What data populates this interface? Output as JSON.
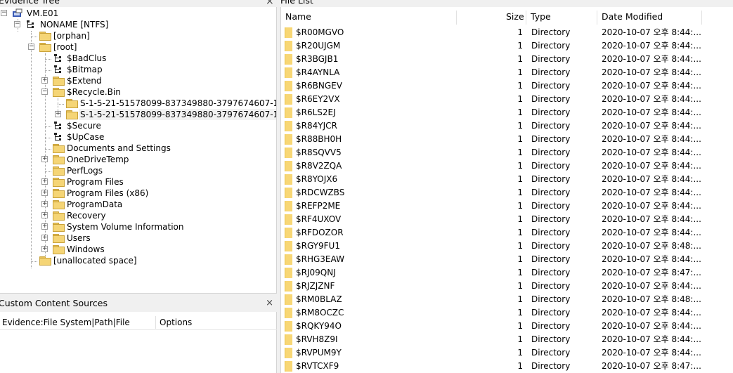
{
  "evidence_tree": {
    "title": "Evidence Tree",
    "close": "×",
    "nodes": [
      {
        "label": "VM.E01",
        "icon": "evidence-icon",
        "expander": "−"
      },
      {
        "label": "NONAME [NTFS]",
        "icon": "filesystem-icon",
        "expander": "−"
      },
      {
        "label": "[orphan]",
        "icon": "folder-icon",
        "expander": ""
      },
      {
        "label": "[root]",
        "icon": "folder-icon",
        "expander": "−"
      },
      {
        "label": "$BadClus",
        "icon": "filesystem-icon",
        "expander": ""
      },
      {
        "label": "$Bitmap",
        "icon": "filesystem-icon",
        "expander": ""
      },
      {
        "label": "$Extend",
        "icon": "folder-icon",
        "expander": "+"
      },
      {
        "label": "$Recycle.Bin",
        "icon": "folder-icon",
        "expander": "−"
      },
      {
        "label": "S-1-5-21-51578099-837349880-3797674607-1000",
        "icon": "folder-icon",
        "expander": ""
      },
      {
        "label": "S-1-5-21-51578099-837349880-3797674607-1001",
        "icon": "folder-icon",
        "expander": "+"
      },
      {
        "label": "$Secure",
        "icon": "filesystem-icon",
        "expander": ""
      },
      {
        "label": "$UpCase",
        "icon": "filesystem-icon",
        "expander": ""
      },
      {
        "label": "Documents and Settings",
        "icon": "folder-icon",
        "expander": ""
      },
      {
        "label": "OneDriveTemp",
        "icon": "folder-icon",
        "expander": "+"
      },
      {
        "label": "PerfLogs",
        "icon": "folder-icon",
        "expander": ""
      },
      {
        "label": "Program Files",
        "icon": "folder-icon",
        "expander": "+"
      },
      {
        "label": "Program Files (x86)",
        "icon": "folder-icon",
        "expander": "+"
      },
      {
        "label": "ProgramData",
        "icon": "folder-icon",
        "expander": "+"
      },
      {
        "label": "Recovery",
        "icon": "folder-icon",
        "expander": "+"
      },
      {
        "label": "System Volume Information",
        "icon": "folder-icon",
        "expander": "+"
      },
      {
        "label": "Users",
        "icon": "folder-icon",
        "expander": "+"
      },
      {
        "label": "Windows",
        "icon": "folder-icon",
        "expander": "+"
      },
      {
        "label": "[unallocated space]",
        "icon": "folder-icon",
        "expander": ""
      }
    ]
  },
  "custom_content_sources": {
    "title": "Custom Content Sources",
    "close": "×",
    "columns": [
      "Evidence:File System|Path|File",
      "Options"
    ]
  },
  "file_list": {
    "title": "File List",
    "columns": {
      "name": "Name",
      "size": "Size",
      "type": "Type",
      "date": "Date Modified"
    },
    "rows": [
      {
        "name": "$R00MGVO",
        "size": "1",
        "type": "Directory",
        "date": "2020-10-07 오후 8:44:..."
      },
      {
        "name": "$R20UJGM",
        "size": "1",
        "type": "Directory",
        "date": "2020-10-07 오후 8:44:..."
      },
      {
        "name": "$R3BGJB1",
        "size": "1",
        "type": "Directory",
        "date": "2020-10-07 오후 8:44:..."
      },
      {
        "name": "$R4AYNLA",
        "size": "1",
        "type": "Directory",
        "date": "2020-10-07 오후 8:44:..."
      },
      {
        "name": "$R6BNGEV",
        "size": "1",
        "type": "Directory",
        "date": "2020-10-07 오후 8:44:..."
      },
      {
        "name": "$R6EY2VX",
        "size": "1",
        "type": "Directory",
        "date": "2020-10-07 오후 8:44:..."
      },
      {
        "name": "$R6LS2EJ",
        "size": "1",
        "type": "Directory",
        "date": "2020-10-07 오후 8:44:..."
      },
      {
        "name": "$R84YJCR",
        "size": "1",
        "type": "Directory",
        "date": "2020-10-07 오후 8:44:..."
      },
      {
        "name": "$R88BH0H",
        "size": "1",
        "type": "Directory",
        "date": "2020-10-07 오후 8:44:..."
      },
      {
        "name": "$R8SQVV5",
        "size": "1",
        "type": "Directory",
        "date": "2020-10-07 오후 8:44:..."
      },
      {
        "name": "$R8V2ZQA",
        "size": "1",
        "type": "Directory",
        "date": "2020-10-07 오후 8:44:..."
      },
      {
        "name": "$R8YOJX6",
        "size": "1",
        "type": "Directory",
        "date": "2020-10-07 오후 8:44:..."
      },
      {
        "name": "$RDCWZBS",
        "size": "1",
        "type": "Directory",
        "date": "2020-10-07 오후 8:44:..."
      },
      {
        "name": "$REFP2ME",
        "size": "1",
        "type": "Directory",
        "date": "2020-10-07 오후 8:44:..."
      },
      {
        "name": "$RF4UXOV",
        "size": "1",
        "type": "Directory",
        "date": "2020-10-07 오후 8:44:..."
      },
      {
        "name": "$RFDOZOR",
        "size": "1",
        "type": "Directory",
        "date": "2020-10-07 오후 8:44:..."
      },
      {
        "name": "$RGY9FU1",
        "size": "1",
        "type": "Directory",
        "date": "2020-10-07 오후 8:48:..."
      },
      {
        "name": "$RHG3EAW",
        "size": "1",
        "type": "Directory",
        "date": "2020-10-07 오후 8:44:..."
      },
      {
        "name": "$RJ09QNJ",
        "size": "1",
        "type": "Directory",
        "date": "2020-10-07 오후 8:47:..."
      },
      {
        "name": "$RJZJZNF",
        "size": "1",
        "type": "Directory",
        "date": "2020-10-07 오후 8:44:..."
      },
      {
        "name": "$RM0BLAZ",
        "size": "1",
        "type": "Directory",
        "date": "2020-10-07 오후 8:48:..."
      },
      {
        "name": "$RM8OCZC",
        "size": "1",
        "type": "Directory",
        "date": "2020-10-07 오후 8:44:..."
      },
      {
        "name": "$RQKY94O",
        "size": "1",
        "type": "Directory",
        "date": "2020-10-07 오후 8:44:..."
      },
      {
        "name": "$RVH8Z9I",
        "size": "1",
        "type": "Directory",
        "date": "2020-10-07 오후 8:44:..."
      },
      {
        "name": "$RVPUM9Y",
        "size": "1",
        "type": "Directory",
        "date": "2020-10-07 오후 8:44:..."
      },
      {
        "name": "$RVTCXF9",
        "size": "1",
        "type": "Directory",
        "date": "2020-10-07 오후 8:47:..."
      }
    ]
  }
}
